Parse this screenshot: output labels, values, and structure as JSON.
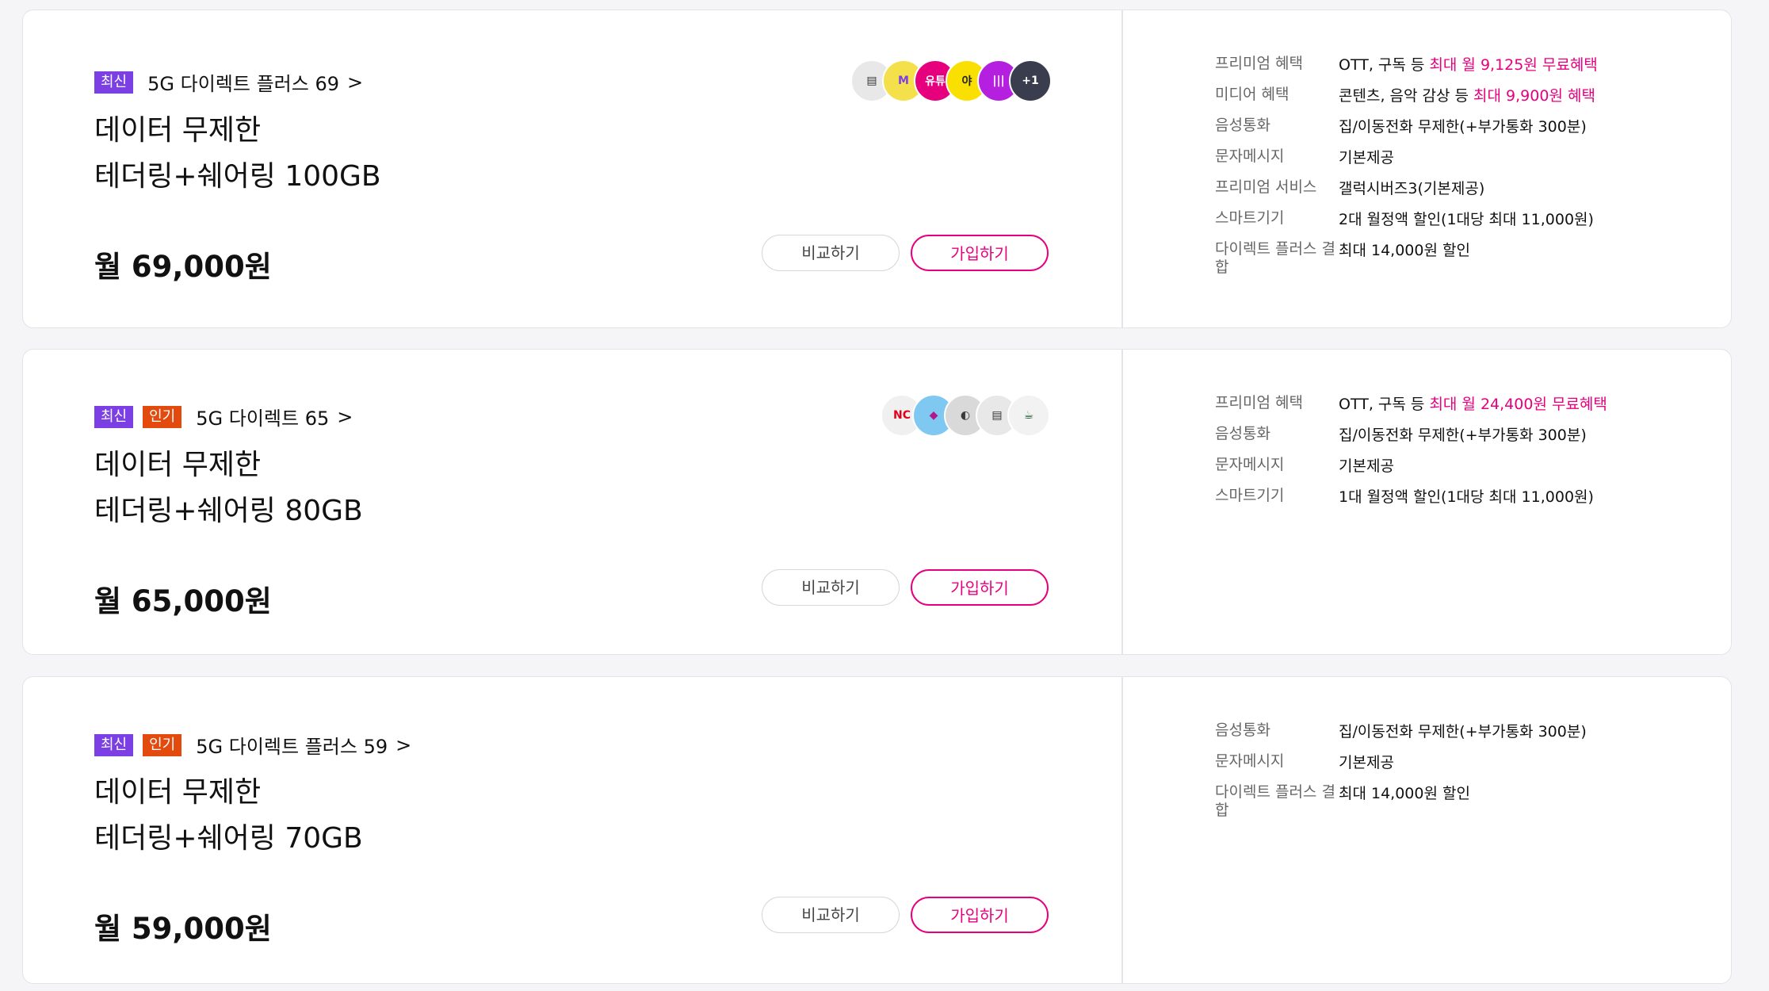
{
  "plans": [
    {
      "badges": [
        "최신"
      ],
      "name": "5G 다이렉트 플러스 69",
      "title_line1": "데이터 무제한",
      "title_line2": "테더링+쉐어링 100GB",
      "price": "월 69,000원",
      "compare_label": "비교하기",
      "join_label": "가입하기",
      "icons": [
        {
          "name": "tv-box-icon",
          "text": "▤",
          "bg": "#e8e8e8",
          "fg": "#333"
        },
        {
          "name": "music-wave-icon",
          "text": "M",
          "bg": "#f4e04a",
          "fg": "#7b3fe4"
        },
        {
          "name": "youtube-app-icon",
          "text": "유튜",
          "bg": "#e6007e",
          "fg": "#fff"
        },
        {
          "name": "yogiyo-app-icon",
          "text": "야",
          "bg": "#f9e000",
          "fg": "#222"
        },
        {
          "name": "audio-bars-icon",
          "text": "|||",
          "bg": "#b51fe0",
          "fg": "#fff"
        }
      ],
      "more_icon": "+1",
      "benefits": [
        {
          "label": "프리미엄 혜택",
          "value": "OTT, 구독 등 ",
          "highlight": "최대 월 9,125원 무료혜택"
        },
        {
          "label": "미디어 혜택",
          "value": "콘텐츠, 음악 감상 등 ",
          "highlight": "최대 9,900원 혜택"
        },
        {
          "label": "음성통화",
          "value": "집/이동전화 무제한(+부가통화 300분)",
          "highlight": ""
        },
        {
          "label": "문자메시지",
          "value": "기본제공",
          "highlight": ""
        },
        {
          "label": "프리미엄 서비스",
          "value": "갤럭시버즈3(기본제공)",
          "highlight": ""
        },
        {
          "label": "스마트기기",
          "value": "2대 월정액 할인(1대당 최대 11,000원)",
          "highlight": ""
        },
        {
          "label": "다이렉트 플러스 결합",
          "value": "최대 14,000원 할인",
          "highlight": ""
        }
      ]
    },
    {
      "badges": [
        "최신",
        "인기"
      ],
      "name": "5G 다이렉트 65",
      "title_line1": "데이터 무제한",
      "title_line2": "테더링+쉐어링 80GB",
      "price": "월 65,000원",
      "compare_label": "비교하기",
      "join_label": "가입하기",
      "icons": [
        {
          "name": "nc-logo-icon",
          "text": "NC",
          "bg": "#f0f0f0",
          "fg": "#e2001a"
        },
        {
          "name": "webtoon-character-icon",
          "text": "◆",
          "bg": "#7ec8f2",
          "fg": "#b4168d"
        },
        {
          "name": "galaxy-buds-icon",
          "text": "◐",
          "bg": "#d9d9d9",
          "fg": "#3a3a3a"
        },
        {
          "name": "tv-box-icon",
          "text": "▤",
          "bg": "#e8e8e8",
          "fg": "#333"
        },
        {
          "name": "coffee-cup-icon",
          "text": "☕",
          "bg": "#f2f2f2",
          "fg": "#1e5631"
        }
      ],
      "more_icon": "",
      "benefits": [
        {
          "label": "프리미엄 혜택",
          "value": "OTT, 구독 등 ",
          "highlight": "최대 월 24,400원 무료혜택"
        },
        {
          "label": "음성통화",
          "value": "집/이동전화 무제한(+부가통화 300분)",
          "highlight": ""
        },
        {
          "label": "문자메시지",
          "value": "기본제공",
          "highlight": ""
        },
        {
          "label": "스마트기기",
          "value": "1대 월정액 할인(1대당 최대 11,000원)",
          "highlight": ""
        }
      ]
    },
    {
      "badges": [
        "최신",
        "인기"
      ],
      "name": "5G 다이렉트 플러스 59",
      "title_line1": "데이터 무제한",
      "title_line2": "테더링+쉐어링 70GB",
      "price": "월 59,000원",
      "compare_label": "비교하기",
      "join_label": "가입하기",
      "icons": [],
      "more_icon": "",
      "benefits": [
        {
          "label": "음성통화",
          "value": "집/이동전화 무제한(+부가통화 300분)",
          "highlight": ""
        },
        {
          "label": "문자메시지",
          "value": "기본제공",
          "highlight": ""
        },
        {
          "label": "다이렉트 플러스 결합",
          "value": "최대 14,000원 할인",
          "highlight": ""
        }
      ]
    }
  ],
  "colors": {
    "accent": "#e6007e",
    "badge_new": "#7b3fe4",
    "badge_hot": "#e24a0e"
  }
}
